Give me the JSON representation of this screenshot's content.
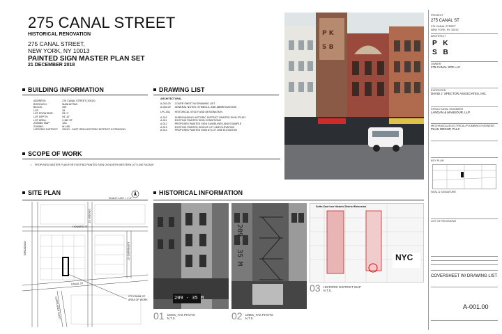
{
  "header": {
    "title": "275 CANAL STREET",
    "subtitle": "HISTORICAL RENOVATION",
    "address_line1": "275 CANAL STREET,",
    "address_line2": "NEW YORK, NY 10013",
    "set_title": "PAINTED SIGN MASTER PLAN SET",
    "date": "21 DECEMBER 2018"
  },
  "building_info": {
    "heading": "BUILDING INFORMATION",
    "rows": [
      {
        "k": "ADDRESS:",
        "v": "275 CANAL STREET (10013)"
      },
      {
        "k": "BOROUGH:",
        "v": "MANHATTAN"
      },
      {
        "k": "BLOCK:",
        "v": "209"
      },
      {
        "k": "LOT:",
        "v": "35"
      },
      {
        "k": "LOT FRONTAGE:",
        "v": "25'-1\""
      },
      {
        "k": "LOT DEPTH:",
        "v": "94'-10\""
      },
      {
        "k": "LOT AREA:",
        "v": "2,382 SF"
      },
      {
        "k": "ZONING MAP:",
        "v": "12A"
      },
      {
        "k": "ZONING:",
        "v": "M1-5B"
      },
      {
        "k": "HISTORIC DISTRICT:",
        "v": "SOHO - CAST IRON HISTORIC DISTRICT EXTENSION"
      }
    ]
  },
  "drawing_list": {
    "heading": "DRAWING LIST",
    "group": "ARCHITECTURAL",
    "rows": [
      {
        "k": "A-001.00",
        "v": "COVER SHEET W/ DRAWING LIST"
      },
      {
        "k": "A-002.00",
        "v": "GENERAL NOTES, SYMBOLS, AND ABBREVIATIONS"
      },
      {
        "k": "LPC-001",
        "v": "HISTORICAL STUDY AND DESIGNATION"
      },
      {
        "k": "A-010",
        "v": "SURROUNDING HISTORIC DISTRICT PAINTED SIGN STUDY"
      },
      {
        "k": "A-011",
        "v": "EXISTING PAINTED SIGN CONDITIONS"
      },
      {
        "k": "A-012",
        "v": "PROPOSED PAINTED SIGN GUIDELINES AND EXAMPLE"
      },
      {
        "k": "A-013",
        "v": "EXISTING PAINTED SIGN AT LOT LINE ELEVATION"
      },
      {
        "k": "A-014",
        "v": "PROPOSED PAINTED SIGN AT LOT LINE ELEVATION"
      }
    ]
  },
  "scope": {
    "heading": "SCOPE OF WORK",
    "item": "PROPOSED MASTER PLAN FOR EXISTING PAINTED SIGN ON NORTH WESTERN LOT LINE FACADE."
  },
  "site_plan": {
    "heading": "SITE PLAN",
    "scale": "SCALE: 1/64\" = 1'-0\"",
    "streets": [
      "HOWARD ST",
      "BROADWAY",
      "CROSBY ST",
      "LISPENARD ST",
      "CANAL ST",
      "CORTLANDT ALLEY"
    ],
    "label_line1": "275 CANAL ST",
    "label_line2": "AREA OF WORK"
  },
  "historical": {
    "heading": "HISTORICAL INFORMATION",
    "photo1_sign": "209 - 35 M",
    "photo2_sign": "209 - 35 M",
    "captions": [
      {
        "num": "01",
        "text": "1940s_TAX PHOTO",
        "sub": "N.T.S."
      },
      {
        "num": "02",
        "text": "1980s_TAX PHOTO",
        "sub": "N.T.S."
      },
      {
        "num": "03",
        "text": "HISTORIC DISTRICT MAP",
        "sub": "N.T.S."
      }
    ],
    "map_title": "SoHo-Cast Iron Historic District Extension",
    "nyc": "NYC"
  },
  "title_block": {
    "project_label": "PROJECT",
    "project_name": "275 CANAL ST",
    "project_addr1": "275 CANAL STREET",
    "project_addr2": "NEW YORK, NY 10013",
    "architect_label": "ARCHITECT",
    "logo_letters": [
      "P",
      "K",
      "S",
      "B"
    ],
    "owner_label": "OWNER",
    "owner_name": "275 CANAL SPE LLC",
    "expediter_label": "EXPEDITER",
    "expediter_name": "DAVID J. SPECTOR ASSOCIATES, INC.",
    "structural_label": "STRUCTURAL ENGINEER",
    "structural_name": "LANGAN & MANSOUR, LLP",
    "mep_label": "MECHANICAL/ELECTRICAL/PLUMBING ENGINEER",
    "mep_name": "PLUS GROUP, PLLC",
    "keyplan_label": "KEY PLAN",
    "seal_label": "SEAL & SIGNATURE",
    "revisions_label": "LIST OF REVISIONS",
    "sheet_title": "COVERSHEET W/ DRAWING LIST",
    "drawing_number": "A-001.00"
  }
}
